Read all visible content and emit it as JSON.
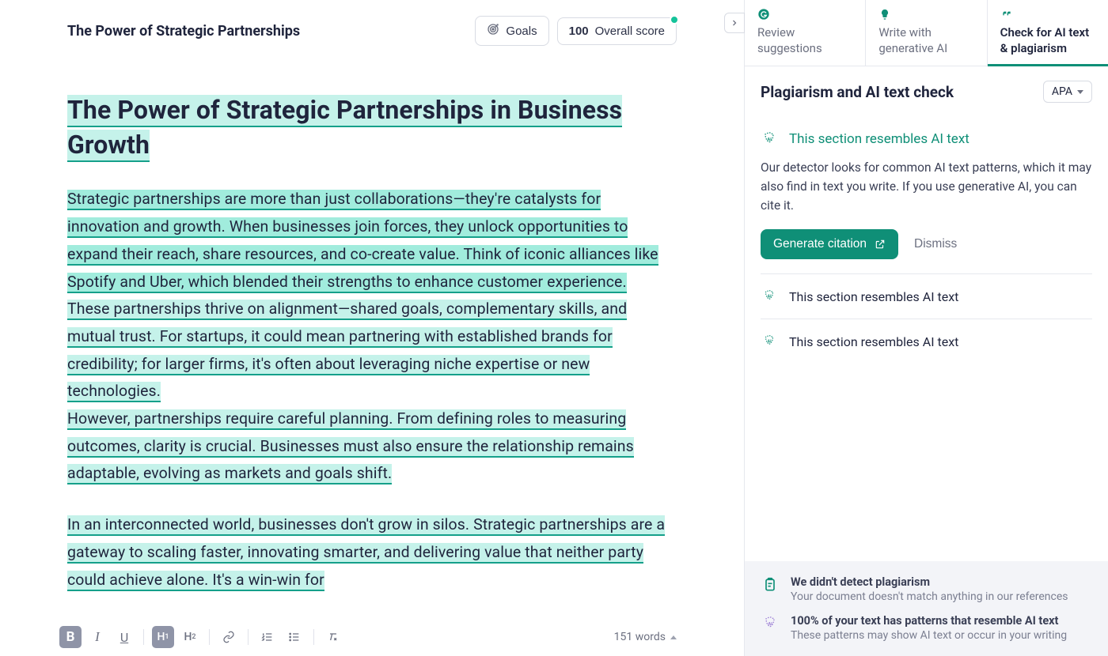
{
  "document": {
    "title": "The Power of Strategic Partnerships",
    "heading": "The Power of Strategic Partnerships in Business Growth",
    "paragraphs": [
      "Strategic partnerships are more than just collaborations—they're catalysts for innovation and growth. When businesses join forces, they unlock opportunities to expand their reach, share resources, and co-create value. Think of iconic alliances like Spotify and Uber, which blended their strengths to enhance customer experience.",
      "These partnerships thrive on alignment—shared goals, complementary skills, and mutual trust. For startups, it could mean partnering with established brands for credibility; for larger firms, it's often about leveraging niche expertise or new technologies.",
      "However, partnerships require careful planning. From defining roles to measuring outcomes, clarity is crucial. Businesses must also ensure the relationship remains adaptable, evolving as markets and goals shift.",
      "In an interconnected world, businesses don't grow in silos. Strategic partnerships are a gateway to scaling faster, innovating smarter, and delivering value that neither party could achieve alone. It's a win-win for"
    ],
    "word_count_label": "151 words"
  },
  "header": {
    "goals_label": "Goals",
    "score_value": "100",
    "score_label": "Overall score"
  },
  "sidebar": {
    "tabs": [
      {
        "label": "Review suggestions"
      },
      {
        "label": "Write with generative AI"
      },
      {
        "label": "Check for AI text & plagiarism"
      }
    ],
    "panel_title": "Plagiarism and AI text check",
    "citation_style": "APA",
    "issues": [
      {
        "label": "This section resembles AI text",
        "expanded": true,
        "body": "Our detector looks for common AI text patterns, which it may also find in text you write. If you use generative AI, you can cite it.",
        "primary_action": "Generate citation",
        "secondary_action": "Dismiss"
      },
      {
        "label": "This section resembles AI text",
        "expanded": false
      },
      {
        "label": "This section resembles AI text",
        "expanded": false
      }
    ],
    "summary": [
      {
        "icon": "clipboard",
        "title": "We didn't detect plagiarism",
        "desc": "Your document doesn't match anything in our references"
      },
      {
        "icon": "ai",
        "title": "100% of your text has patterns that resemble AI text",
        "desc": "These patterns may show AI text or occur in your writing"
      }
    ]
  },
  "colors": {
    "accent": "#0f8f77",
    "highlight": "#c5f2ea"
  }
}
